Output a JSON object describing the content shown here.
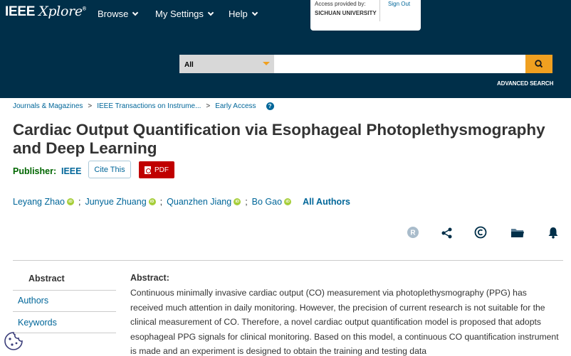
{
  "header": {
    "logo_main": "IEEE",
    "logo_script": "Xplore",
    "logo_mark": "®",
    "nav": [
      {
        "label": "Browse"
      },
      {
        "label": "My Settings"
      },
      {
        "label": "Help"
      }
    ],
    "access_label": "Access provided by:",
    "access_institution": "SICHUAN UNIVERSITY",
    "sign_out": "Sign Out",
    "search_scope": "All",
    "search_value": "",
    "advanced_search": "ADVANCED SEARCH",
    "accent_color": "#f0a020",
    "bg_color": "#002f49"
  },
  "breadcrumb": {
    "items": [
      "Journals & Magazines",
      "IEEE Transactions on Instrume...",
      "Early Access"
    ],
    "separator": ">",
    "help_glyph": "?"
  },
  "article": {
    "title": "Cardiac Output Quantification via Esophageal Photoplethysmography and Deep Learning",
    "publisher_label": "Publisher:",
    "publisher": "IEEE",
    "cite_label": "Cite This",
    "pdf_label": "PDF",
    "authors": [
      "Leyang Zhao",
      "Junyue Zhuang",
      "Quanzhen Jiang",
      "Bo Gao"
    ],
    "author_separator": ";",
    "orcid_glyph": "iD",
    "all_authors": "All Authors"
  },
  "toolbar": {
    "icons": [
      "rights-icon",
      "share-icon",
      "copyright-icon",
      "folder-icon",
      "alert-bell-icon"
    ]
  },
  "sidebar": {
    "items": [
      "Abstract",
      "Authors",
      "Keywords"
    ]
  },
  "abstract": {
    "heading": "Abstract:",
    "text": "Continuous minimally invasive cardiac output (CO) measurement via photoplethysmography (PPG) has received much attention in daily monitoring. However, the precision of current research is not suitable for the clinical measurement of CO. Therefore, a novel cardiac output quantification model is proposed that adopts esophageal PPG signals for clinical monitoring. Based on this model, a continuous CO quantification instrument is made and an experiment is designed to obtain the training and testing data"
  }
}
